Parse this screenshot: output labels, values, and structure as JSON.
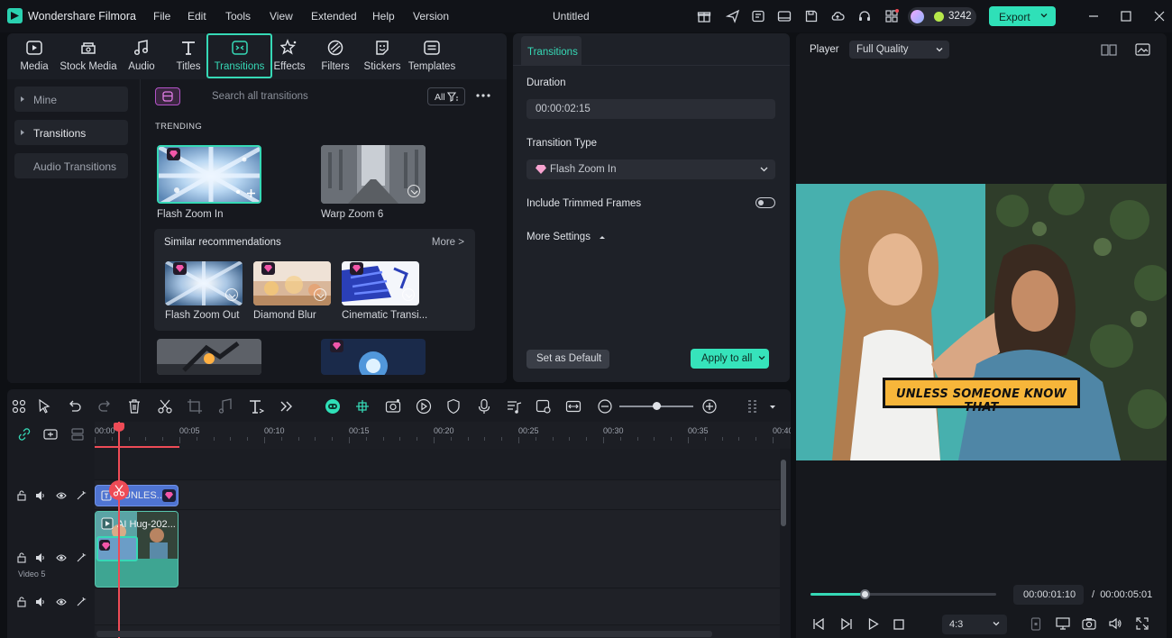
{
  "app": {
    "name": "Wondershare Filmora",
    "document_title": "Untitled",
    "menu": [
      "File",
      "Edit",
      "Tools",
      "View",
      "Extended",
      "Help",
      "Version"
    ],
    "credits": "3242",
    "export_label": "Export",
    "accent_color": "#36d9b6"
  },
  "media_toolbar": {
    "tabs": [
      {
        "label": "Media",
        "icon": "media-icon"
      },
      {
        "label": "Stock Media",
        "icon": "stock-media-icon"
      },
      {
        "label": "Audio",
        "icon": "music-note-icon"
      },
      {
        "label": "Titles",
        "icon": "text-t-icon"
      },
      {
        "label": "Transitions",
        "icon": "transitions-icon",
        "active": true
      },
      {
        "label": "Effects",
        "icon": "effects-icon"
      },
      {
        "label": "Filters",
        "icon": "filters-icon"
      },
      {
        "label": "Stickers",
        "icon": "stickers-icon"
      },
      {
        "label": "Templates",
        "icon": "templates-icon"
      }
    ]
  },
  "sidebar": {
    "items": [
      {
        "label": "Mine",
        "expandable": true
      },
      {
        "label": "Transitions",
        "expandable": true
      },
      {
        "label": "Audio Transitions",
        "expandable": false
      }
    ]
  },
  "library": {
    "search_placeholder": "Search all transitions",
    "filter_label": "All",
    "section_label": "TRENDING",
    "trending": [
      {
        "label": "Flash Zoom In",
        "selected": true
      },
      {
        "label": "Warp Zoom 6"
      }
    ],
    "similar": {
      "title": "Similar recommendations",
      "more_label": "More >",
      "items": [
        {
          "label": "Flash Zoom Out"
        },
        {
          "label": "Diamond Blur"
        },
        {
          "label": "Cinematic Transi..."
        }
      ]
    }
  },
  "properties": {
    "tab_label": "Transitions",
    "duration_label": "Duration",
    "duration_value": "00:00:02:15",
    "type_label": "Transition Type",
    "type_value": "Flash Zoom In",
    "trimmed_label": "Include Trimmed Frames",
    "trimmed_enabled": false,
    "more_settings_label": "More Settings",
    "default_button": "Set as Default",
    "apply_button": "Apply to all"
  },
  "player": {
    "label": "Player",
    "quality": "Full Quality",
    "caption_text": "UNLESS SOMEONE KNOW THAT",
    "progress_fraction": 0.29,
    "current_time": "00:00:01:10",
    "total_time_sep": "/",
    "total_time": "00:00:05:01",
    "aspect_ratio": "4:3"
  },
  "timeline": {
    "ruler_labels": [
      "00:00",
      "00:05",
      "00:10",
      "00:15",
      "00:20",
      "00:25",
      "00:30",
      "00:35",
      "00:40"
    ],
    "zoom_fraction": 0.5,
    "track_label": "Video 5",
    "title_clip_label": "UNLES...",
    "video_clip_label": "AI Hug-202..."
  }
}
